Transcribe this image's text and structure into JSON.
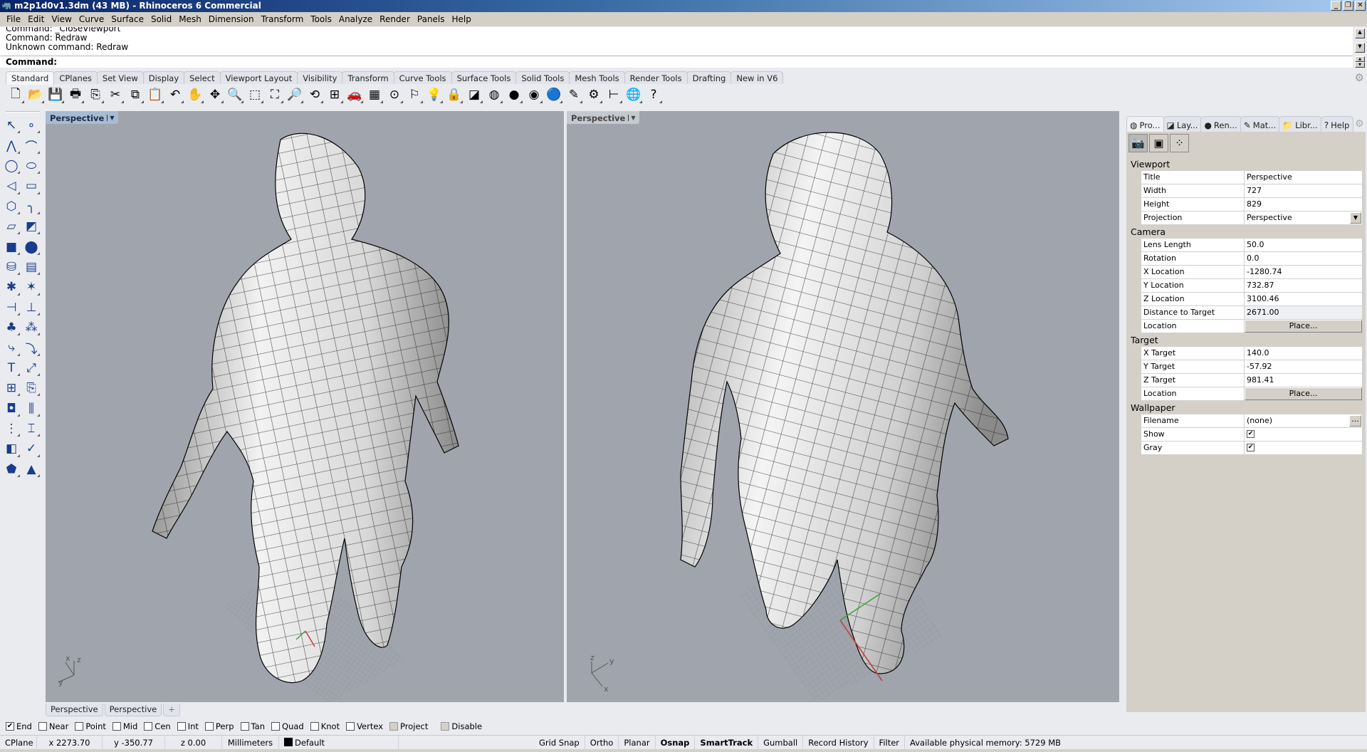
{
  "window": {
    "title": "m2p1d0v1.3dm (43 MB) - Rhinoceros 6 Commercial",
    "logo": "rhino-logo",
    "controls": {
      "minimize": "_",
      "restore": "❐",
      "close": "✕"
    }
  },
  "menu": [
    "File",
    "Edit",
    "View",
    "Curve",
    "Surface",
    "Solid",
    "Mesh",
    "Dimension",
    "Transform",
    "Tools",
    "Analyze",
    "Render",
    "Panels",
    "Help"
  ],
  "command": {
    "history": [
      "Command: _CloseViewport",
      "Command: Redraw",
      "Unknown command: Redraw"
    ],
    "prompt": "Command:"
  },
  "toolbar_tabs": [
    "Standard",
    "CPlanes",
    "Set View",
    "Display",
    "Select",
    "Viewport Layout",
    "Visibility",
    "Transform",
    "Curve Tools",
    "Surface Tools",
    "Solid Tools",
    "Mesh Tools",
    "Render Tools",
    "Drafting",
    "New in V6"
  ],
  "toolbar_active_tab": "Standard",
  "standard_icons": [
    {
      "name": "new-icon",
      "glyph": "🗋"
    },
    {
      "name": "open-icon",
      "glyph": "📂"
    },
    {
      "name": "save-icon",
      "glyph": "💾"
    },
    {
      "name": "print-icon",
      "glyph": "🖶"
    },
    {
      "name": "import-icon",
      "glyph": "⎘"
    },
    {
      "name": "cut-icon",
      "glyph": "✂"
    },
    {
      "name": "copy-icon",
      "glyph": "⧉"
    },
    {
      "name": "paste-icon",
      "glyph": "📋"
    },
    {
      "name": "undo-icon",
      "glyph": "↶"
    },
    {
      "name": "pan-icon",
      "glyph": "✋"
    },
    {
      "name": "rotate-view-icon",
      "glyph": "✥"
    },
    {
      "name": "zoom-dynamic-icon",
      "glyph": "🔍"
    },
    {
      "name": "zoom-window-icon",
      "glyph": "⬚"
    },
    {
      "name": "zoom-extents-icon",
      "glyph": "⛶"
    },
    {
      "name": "zoom-selected-icon",
      "glyph": "🔎"
    },
    {
      "name": "undo-view-icon",
      "glyph": "⟲"
    },
    {
      "name": "four-viewports-icon",
      "glyph": "⊞"
    },
    {
      "name": "car-icon",
      "glyph": "🚗"
    },
    {
      "name": "grid-icon",
      "glyph": "▦"
    },
    {
      "name": "osnap-icon",
      "glyph": "⊙"
    },
    {
      "name": "select-filter-icon",
      "glyph": "⚐"
    },
    {
      "name": "light-icon",
      "glyph": "💡"
    },
    {
      "name": "lock-icon",
      "glyph": "🔒"
    },
    {
      "name": "layers-icon",
      "glyph": "◪"
    },
    {
      "name": "color-wheel-icon",
      "glyph": "◍"
    },
    {
      "name": "shaded-sphere-icon",
      "glyph": "●"
    },
    {
      "name": "rendered-sphere-icon",
      "glyph": "◉"
    },
    {
      "name": "render-icon",
      "glyph": "🔵"
    },
    {
      "name": "pencil-icon",
      "glyph": "✎"
    },
    {
      "name": "options-gear-icon",
      "glyph": "⚙"
    },
    {
      "name": "dimension-icon",
      "glyph": "⊢"
    },
    {
      "name": "sphere-globe-icon",
      "glyph": "🌐"
    },
    {
      "name": "help-icon",
      "glyph": "?"
    }
  ],
  "left_toolbar": [
    {
      "name": "select-arrow-icon",
      "glyph": "↖"
    },
    {
      "name": "point-icon",
      "glyph": "∘"
    },
    {
      "name": "polyline-icon",
      "glyph": "⋀"
    },
    {
      "name": "curve-icon",
      "glyph": "⌒"
    },
    {
      "name": "circle-icon",
      "glyph": "◯"
    },
    {
      "name": "ellipse-icon",
      "glyph": "⬭"
    },
    {
      "name": "arc-icon",
      "glyph": "◁"
    },
    {
      "name": "rectangle-icon",
      "glyph": "▭"
    },
    {
      "name": "polygon-icon",
      "glyph": "⬡"
    },
    {
      "name": "fillet-curve-icon",
      "glyph": "╮"
    },
    {
      "name": "surface-points-icon",
      "glyph": "▱"
    },
    {
      "name": "surface-edge-icon",
      "glyph": "◩"
    },
    {
      "name": "box-icon",
      "glyph": "■"
    },
    {
      "name": "boolean-union-icon",
      "glyph": "⬤"
    },
    {
      "name": "cylinder-icon",
      "glyph": "⛁"
    },
    {
      "name": "mesh-icon",
      "glyph": "▤"
    },
    {
      "name": "explode-puzzle-icon",
      "glyph": "✱"
    },
    {
      "name": "explode-icon",
      "glyph": "✶"
    },
    {
      "name": "split-icon",
      "glyph": "⊣"
    },
    {
      "name": "trim-icon",
      "glyph": "⊥"
    },
    {
      "name": "group-icon",
      "glyph": "♣"
    },
    {
      "name": "ungroup-icon",
      "glyph": "⁂"
    },
    {
      "name": "offset-icon",
      "glyph": "⤷"
    },
    {
      "name": "curve-offset-icon",
      "glyph": "⤵"
    },
    {
      "name": "text-icon",
      "glyph": "T"
    },
    {
      "name": "move-icon",
      "glyph": "⤢"
    },
    {
      "name": "array-icon",
      "glyph": "⊞"
    },
    {
      "name": "copy-to-icon",
      "glyph": "⎘"
    },
    {
      "name": "solid-edit-icon",
      "glyph": "◘"
    },
    {
      "name": "extrude-icon",
      "glyph": "⫼"
    },
    {
      "name": "grid-array-icon",
      "glyph": "⋮"
    },
    {
      "name": "dimension-vertical-icon",
      "glyph": "⌶"
    },
    {
      "name": "mirror-icon",
      "glyph": "◧"
    },
    {
      "name": "check-icon",
      "glyph": "✓"
    },
    {
      "name": "solid-shapes-icon",
      "glyph": "⬟"
    },
    {
      "name": "paint-icon",
      "glyph": "▲"
    }
  ],
  "viewports": [
    {
      "title": "Perspective",
      "active": true,
      "axes": {
        "x": "x",
        "y": "y",
        "z": "z"
      }
    },
    {
      "title": "Perspective",
      "active": false,
      "axes": {
        "x": "x",
        "y": "y",
        "z": "z"
      }
    }
  ],
  "viewport_tabs": [
    "Perspective",
    "Perspective"
  ],
  "viewport_tab_add": "+",
  "panel": {
    "tabs": [
      {
        "label": "Pro...",
        "icon": "color-wheel-icon",
        "glyph": "◍"
      },
      {
        "label": "Lay...",
        "icon": "layers-icon",
        "glyph": "◪"
      },
      {
        "label": "Ren...",
        "icon": "render-icon",
        "glyph": "●"
      },
      {
        "label": "Mat...",
        "icon": "material-icon",
        "glyph": "✎"
      },
      {
        "label": "Libr...",
        "icon": "folder-icon",
        "glyph": "📁"
      },
      {
        "label": "Help",
        "icon": "help-icon",
        "glyph": "?"
      }
    ],
    "view_icons": [
      {
        "name": "camera-icon",
        "glyph": "📷"
      },
      {
        "name": "viewport-frame-icon",
        "glyph": "▣"
      },
      {
        "name": "object-spheres-icon",
        "glyph": "⁘"
      }
    ],
    "sections": [
      {
        "title": "Viewport",
        "rows": [
          {
            "label": "Title",
            "value": "Perspective"
          },
          {
            "label": "Width",
            "value": "727"
          },
          {
            "label": "Height",
            "value": "829"
          },
          {
            "label": "Projection",
            "value": "Perspective",
            "type": "dropdown"
          }
        ]
      },
      {
        "title": "Camera",
        "rows": [
          {
            "label": "Lens Length",
            "value": "50.0"
          },
          {
            "label": "Rotation",
            "value": "0.0"
          },
          {
            "label": "X Location",
            "value": "-1280.74"
          },
          {
            "label": "Y Location",
            "value": "732.87"
          },
          {
            "label": "Z Location",
            "value": "3100.46"
          },
          {
            "label": "Distance to Target",
            "value": "2671.00",
            "type": "readonly"
          },
          {
            "label": "Location",
            "value": "Place...",
            "type": "button"
          }
        ]
      },
      {
        "title": "Target",
        "rows": [
          {
            "label": "X Target",
            "value": "140.0"
          },
          {
            "label": "Y Target",
            "value": "-57.92"
          },
          {
            "label": "Z Target",
            "value": "981.41"
          },
          {
            "label": "Location",
            "value": "Place...",
            "type": "button"
          }
        ]
      },
      {
        "title": "Wallpaper",
        "rows": [
          {
            "label": "Filename",
            "value": "(none)",
            "type": "file"
          },
          {
            "label": "Show",
            "value": true,
            "type": "checkbox"
          },
          {
            "label": "Gray",
            "value": true,
            "type": "checkbox"
          }
        ]
      }
    ]
  },
  "osnaps": [
    {
      "label": "End",
      "checked": true,
      "type": "checkbox"
    },
    {
      "label": "Near",
      "checked": false,
      "type": "checkbox"
    },
    {
      "label": "Point",
      "checked": false,
      "type": "checkbox"
    },
    {
      "label": "Mid",
      "checked": false,
      "type": "checkbox"
    },
    {
      "label": "Cen",
      "checked": false,
      "type": "checkbox"
    },
    {
      "label": "Int",
      "checked": false,
      "type": "checkbox"
    },
    {
      "label": "Perp",
      "checked": false,
      "type": "checkbox"
    },
    {
      "label": "Tan",
      "checked": false,
      "type": "checkbox"
    },
    {
      "label": "Quad",
      "checked": false,
      "type": "checkbox"
    },
    {
      "label": "Knot",
      "checked": false,
      "type": "checkbox"
    },
    {
      "label": "Vertex",
      "checked": false,
      "type": "checkbox"
    },
    {
      "label": "Project",
      "checked": false,
      "type": "toggle"
    },
    {
      "label": "Disable",
      "checked": false,
      "type": "toggle"
    }
  ],
  "status": {
    "cplane": "CPlane",
    "x": "x 2273.70",
    "y": "y -350.77",
    "z": "z 0.00",
    "units": "Millimeters",
    "layer": "Default",
    "layer_color": "#000000",
    "toggles": [
      {
        "label": "Grid Snap",
        "on": false
      },
      {
        "label": "Ortho",
        "on": false
      },
      {
        "label": "Planar",
        "on": false
      },
      {
        "label": "Osnap",
        "on": true
      },
      {
        "label": "SmartTrack",
        "on": true
      },
      {
        "label": "Gumball",
        "on": false
      },
      {
        "label": "Record History",
        "on": false
      },
      {
        "label": "Filter",
        "on": false
      }
    ],
    "memory": "Available physical memory: 5729 MB"
  },
  "colors": {
    "viewport_bg": "#a0a5ad",
    "active_label_bg": "#a8bbd4",
    "x_axis": "#c04040",
    "y_axis": "#40a040",
    "model_surface": "#e8e8e8",
    "mesh_wire": "#000000"
  }
}
